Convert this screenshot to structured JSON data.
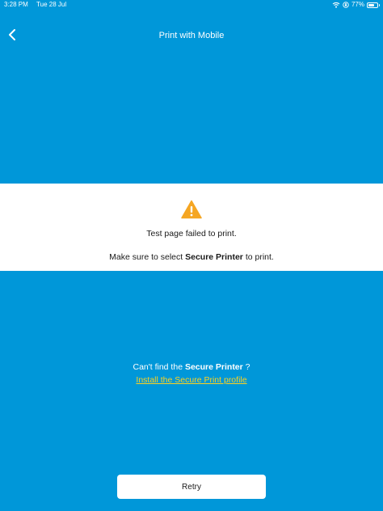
{
  "status_bar": {
    "time": "3:28 PM",
    "date": "Tue 28 Jul",
    "battery_percent": "77%",
    "battery_level": 0.77
  },
  "header": {
    "title": "Print with Mobile",
    "back_icon": "chevron-left-icon"
  },
  "message": {
    "icon": "warning-triangle-icon",
    "icon_color": "#f5a623",
    "failed_text": "Test page failed to print.",
    "instruction_prefix": "Make sure to select ",
    "instruction_bold": "Secure Printer",
    "instruction_suffix": " to print."
  },
  "help": {
    "question_prefix": "Can't find the ",
    "question_bold": "Secure Printer",
    "question_suffix": " ?",
    "install_link": "Install the Secure Print profile"
  },
  "actions": {
    "retry_label": "Retry"
  },
  "colors": {
    "background": "#0097d9",
    "panel": "#ffffff",
    "link": "#ffd21f",
    "warning": "#f5a623"
  }
}
